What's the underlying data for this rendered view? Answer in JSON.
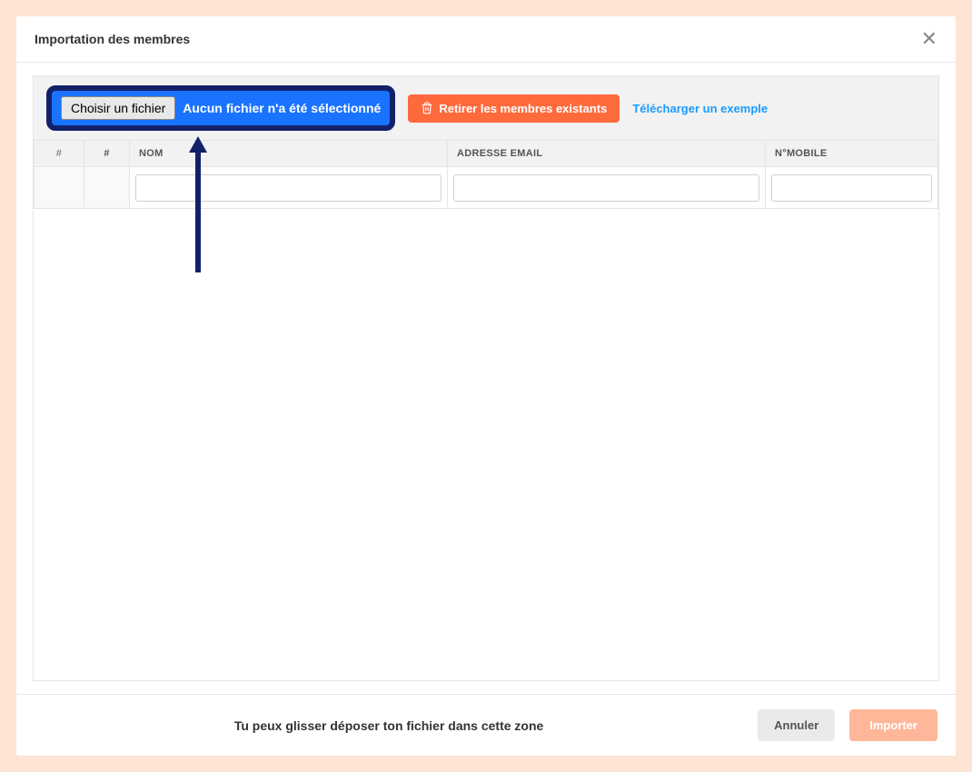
{
  "modal": {
    "title": "Importation des membres"
  },
  "toolbar": {
    "file_button": "Choisir un fichier",
    "file_status": "Aucun fichier n'a été sélectionné",
    "remove_button": "Retirer les membres existants",
    "example_link": "Télécharger un exemple"
  },
  "table": {
    "headers": {
      "num": "#",
      "chk": "#",
      "name": "NOM",
      "email": "ADRESSE EMAIL",
      "mobile": "N°MOBILE"
    }
  },
  "footer": {
    "hint": "Tu peux glisser déposer ton fichier dans cette zone",
    "cancel": "Annuler",
    "import": "Importer"
  },
  "colors": {
    "accent": "#1a73ff",
    "highlight_border": "#13216a",
    "danger": "#ff6a3d",
    "link": "#1a9bff",
    "import_disabled": "#ffb79a",
    "page_bg": "#fde4d4"
  }
}
